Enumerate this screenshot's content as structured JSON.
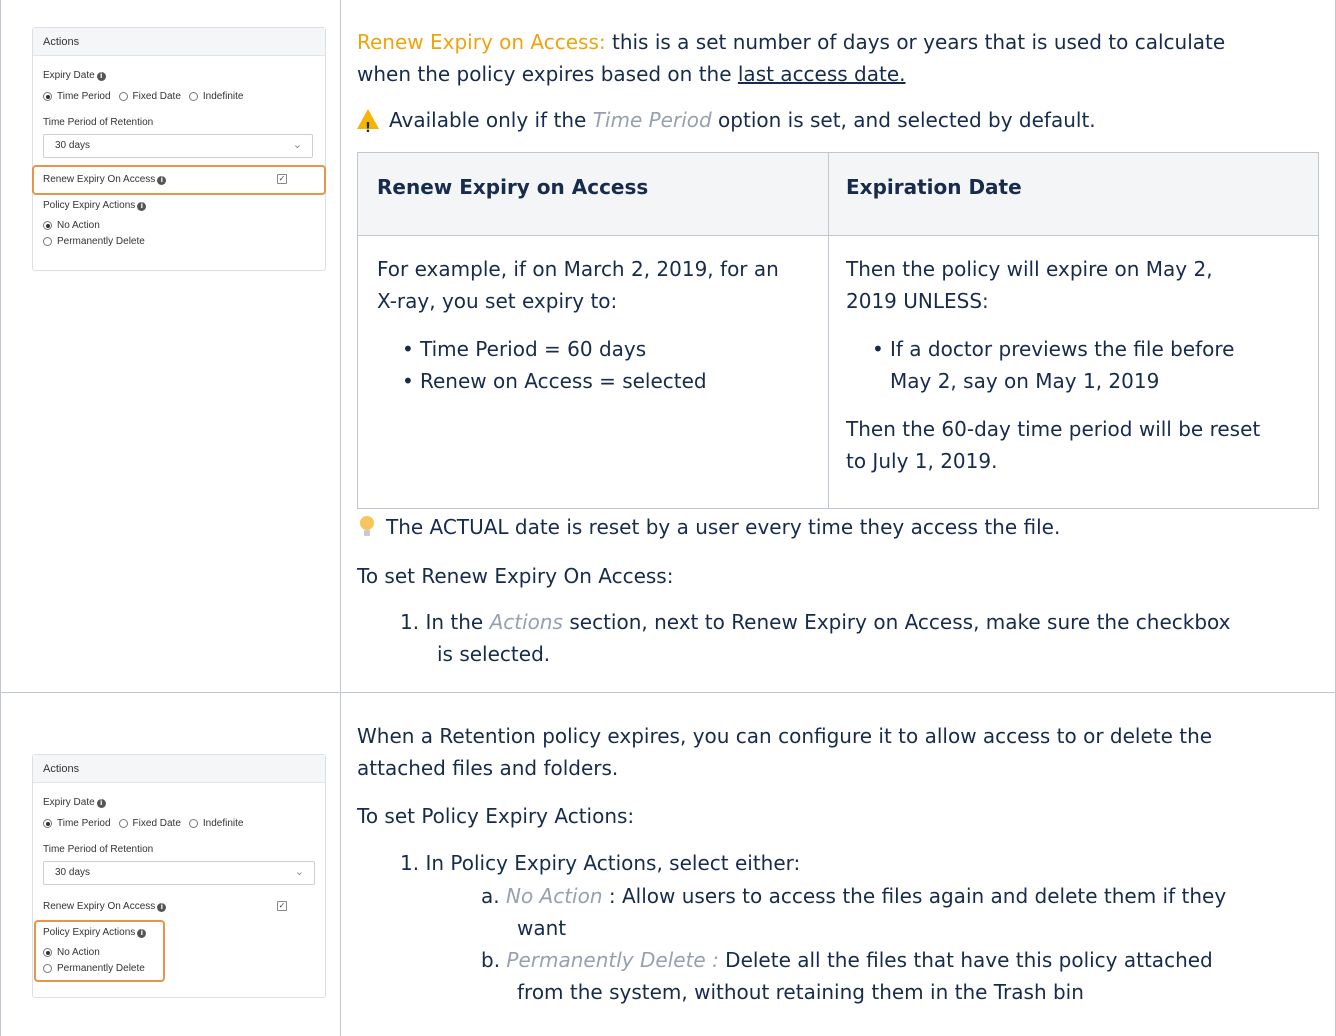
{
  "panel1": {
    "header": "Actions",
    "expiry_date_label": "Expiry Date",
    "radio_options": [
      "Time Period",
      "Fixed Date",
      "Indefinite"
    ],
    "retention_label": "Time Period of Retention",
    "retention_value": "30 days",
    "renew_label": "Renew Expiry On Access",
    "policy_actions_label": "Policy Expiry Actions",
    "policy_options": [
      "No Action",
      "Permanently Delete"
    ]
  },
  "panel2": {
    "header": "Actions",
    "expiry_date_label": "Expiry Date",
    "radio_options": [
      "Time Period",
      "Fixed Date",
      "Indefinite"
    ],
    "retention_label": "Time Period of Retention",
    "retention_value": "30 days",
    "renew_label": "Renew Expiry On Access",
    "policy_actions_label": "Policy Expiry Actions",
    "policy_options": [
      "No Action",
      "Permanently Delete"
    ]
  },
  "section1": {
    "intro_heading": "Renew Expiry on Access:",
    "intro_text_1": " this is a set number of days or years that is used to calculate",
    "intro_text_2": "when the policy expires based on the ",
    "intro_link": "last access date. ",
    "warning_pre": "Available only if the ",
    "warning_em": "Time Period",
    "warning_post": "  option is set, and selected by default.",
    "table": {
      "col1_header": "Renew Expiry on Access",
      "col2_header": "Expiration Date",
      "col1_line1_pre": "For example,",
      "col1_line1_post": " if on March 2, 2019, for an",
      "col1_line2": "X-ray, you set expiry to:",
      "col1_bullets": [
        "Time Period = 60 days",
        "Renew on Access = selected"
      ],
      "col2_line1": "Then the policy will expire on May 2,",
      "col2_line2": "2019 UNLESS:",
      "col2_bullet_1": "If a doctor previews the file before",
      "col2_bullet_2": "May 2, say on May 1, 2019",
      "col2_line3": "Then the 60-day time period will be reset",
      "col2_line4": "to July 1, 2019."
    },
    "tip_text": "The ACTUAL date is reset by a user every time they access the file.",
    "steps_heading": "To set Renew Expiry On Access:",
    "step1_num": "1.",
    "step1_pre": " In the ",
    "step1_em": "Actions",
    "step1_post": " section, next to Renew Expiry on Access, make sure the checkbox",
    "step1_line2": "is selected."
  },
  "section2": {
    "intro_line1": "When a Retention policy expires, you can configure it to allow access to or delete the",
    "intro_line2": "attached files and folders.",
    "steps_heading": "To set Policy Expiry Actions:",
    "step1_num": "1.",
    "step1_text": "In Policy Expiry Actions, select either:",
    "sub_a_letter": "a.",
    "sub_a_em": "No Action",
    "sub_a_text": " :  Allow users to access the files again and delete them if they",
    "sub_a_line2": "want",
    "sub_b_letter": "b.",
    "sub_b_em": "Permanently Delete :",
    "sub_b_text": "  Delete all the files that have this policy attached",
    "sub_b_line2": "from the system, without retaining them in the Trash bin"
  },
  "colors": {
    "accent": "#f0a30a",
    "highlight": "#e8954c",
    "text": "#172b4d",
    "muted": "#97a0af"
  }
}
